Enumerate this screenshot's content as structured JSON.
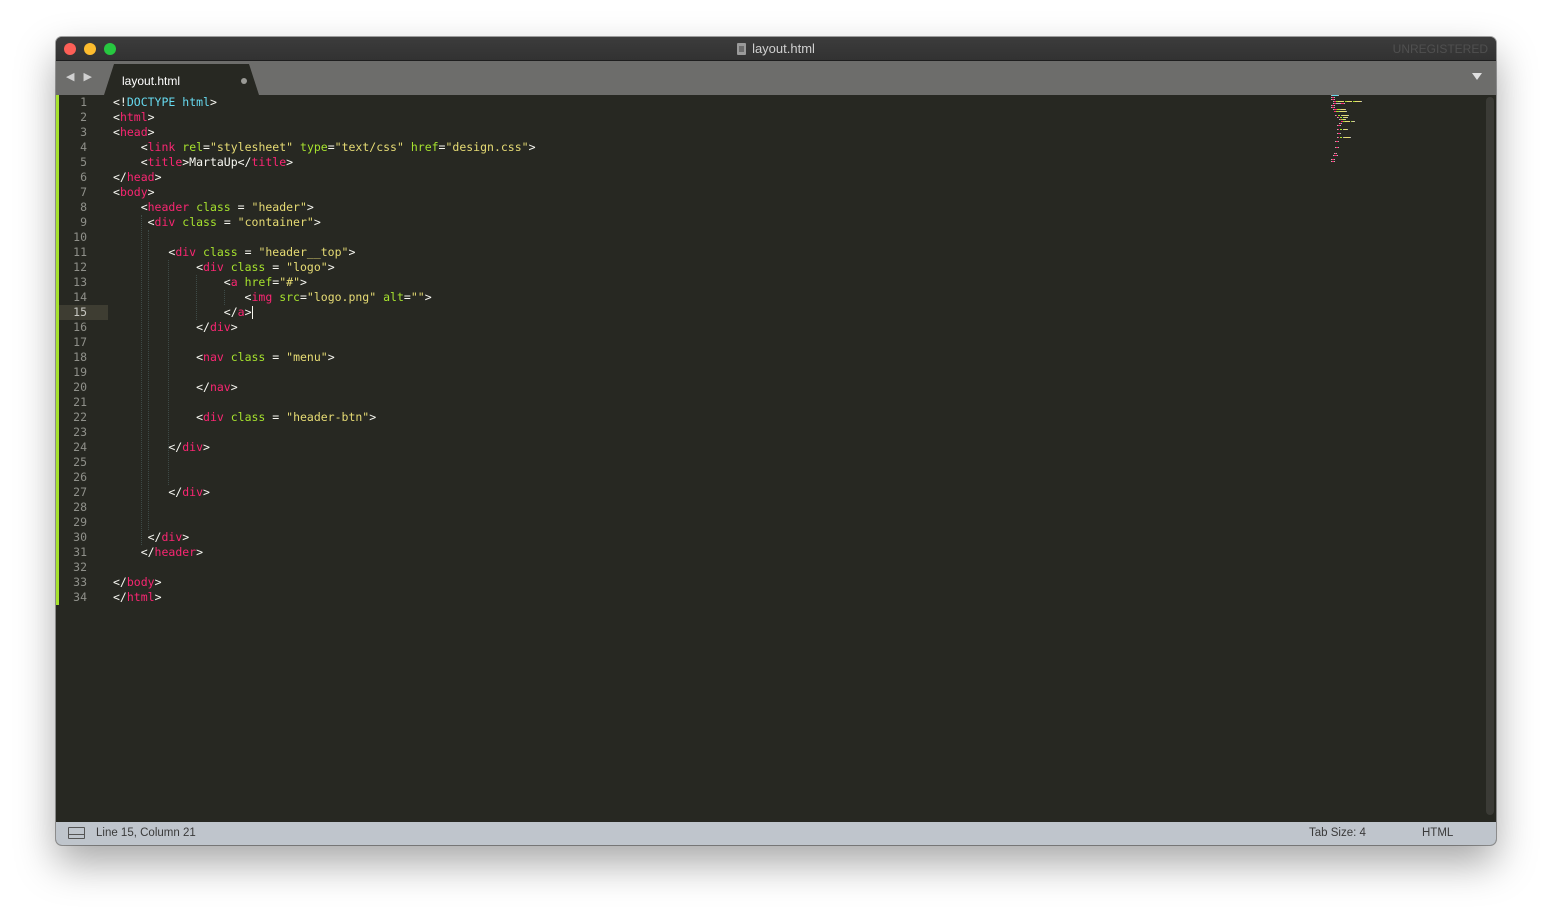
{
  "window": {
    "title": "layout.html",
    "unregistered_label": "UNREGISTERED",
    "traffic_lights": [
      "close",
      "minimize",
      "zoom"
    ]
  },
  "tabs": [
    {
      "label": "layout.html",
      "unsaved": true
    }
  ],
  "editor": {
    "active_line": 15,
    "colors": {
      "background": "#272822",
      "tag": "#f92672",
      "attribute": "#a6e22e",
      "string": "#e6db74",
      "keyword": "#66d9ef",
      "text": "#f8f8f2"
    },
    "lines": [
      [
        [
          "<!",
          ""
        ],
        [
          "DOCTYPE",
          "kw"
        ],
        [
          " ",
          ""
        ],
        [
          "html",
          "kw"
        ],
        [
          ">",
          ""
        ]
      ],
      [
        [
          "<",
          ""
        ],
        [
          "html",
          "tag"
        ],
        [
          ">",
          ""
        ]
      ],
      [
        [
          "<",
          ""
        ],
        [
          "head",
          "tag"
        ],
        [
          ">",
          ""
        ]
      ],
      [
        [
          "    <",
          ""
        ],
        [
          "link",
          "tag"
        ],
        [
          " ",
          ""
        ],
        [
          "rel",
          "attr"
        ],
        [
          "=",
          ""
        ],
        [
          "\"stylesheet\"",
          "str"
        ],
        [
          " ",
          ""
        ],
        [
          "type",
          "attr"
        ],
        [
          "=",
          ""
        ],
        [
          "\"text/css\"",
          "str"
        ],
        [
          " ",
          ""
        ],
        [
          "href",
          "attr"
        ],
        [
          "=",
          ""
        ],
        [
          "\"design.css\"",
          "str"
        ],
        [
          ">",
          ""
        ]
      ],
      [
        [
          "    <",
          ""
        ],
        [
          "title",
          "tag"
        ],
        [
          ">MartaUp</",
          ""
        ],
        [
          "title",
          "tag"
        ],
        [
          ">",
          ""
        ]
      ],
      [
        [
          "</",
          ""
        ],
        [
          "head",
          "tag"
        ],
        [
          ">",
          ""
        ]
      ],
      [
        [
          "<",
          ""
        ],
        [
          "body",
          "tag"
        ],
        [
          ">",
          ""
        ]
      ],
      [
        [
          "    <",
          ""
        ],
        [
          "header",
          "tag"
        ],
        [
          " ",
          ""
        ],
        [
          "class",
          "attr"
        ],
        [
          " = ",
          ""
        ],
        [
          "\"header\"",
          "str"
        ],
        [
          ">",
          ""
        ]
      ],
      [
        [
          "     <",
          ""
        ],
        [
          "div",
          "tag"
        ],
        [
          " ",
          ""
        ],
        [
          "class",
          "attr"
        ],
        [
          " = ",
          ""
        ],
        [
          "\"container\"",
          "str"
        ],
        [
          ">",
          ""
        ]
      ],
      [],
      [
        [
          "        <",
          ""
        ],
        [
          "div",
          "tag"
        ],
        [
          " ",
          ""
        ],
        [
          "class",
          "attr"
        ],
        [
          " = ",
          ""
        ],
        [
          "\"header__top\"",
          "str"
        ],
        [
          ">",
          ""
        ]
      ],
      [
        [
          "            <",
          ""
        ],
        [
          "div",
          "tag"
        ],
        [
          " ",
          ""
        ],
        [
          "class",
          "attr"
        ],
        [
          " = ",
          ""
        ],
        [
          "\"logo\"",
          "str"
        ],
        [
          ">",
          ""
        ]
      ],
      [
        [
          "                <",
          ""
        ],
        [
          "a",
          "tag"
        ],
        [
          " ",
          ""
        ],
        [
          "href",
          "attr"
        ],
        [
          "=",
          ""
        ],
        [
          "\"#\"",
          "str"
        ],
        [
          ">",
          ""
        ]
      ],
      [
        [
          "                   <",
          ""
        ],
        [
          "img",
          "tag"
        ],
        [
          " ",
          ""
        ],
        [
          "src",
          "attr"
        ],
        [
          "=",
          ""
        ],
        [
          "\"logo.png\"",
          "str"
        ],
        [
          " ",
          ""
        ],
        [
          "alt",
          "attr"
        ],
        [
          "=",
          ""
        ],
        [
          "\"\"",
          "str"
        ],
        [
          ">",
          ""
        ]
      ],
      [
        [
          "                </",
          ""
        ],
        [
          "a",
          "tag"
        ],
        [
          ">",
          ""
        ]
      ],
      [
        [
          "            </",
          ""
        ],
        [
          "div",
          "tag"
        ],
        [
          ">",
          ""
        ]
      ],
      [],
      [
        [
          "            <",
          ""
        ],
        [
          "nav",
          "tag"
        ],
        [
          " ",
          ""
        ],
        [
          "class",
          "attr"
        ],
        [
          " = ",
          ""
        ],
        [
          "\"menu\"",
          "str"
        ],
        [
          ">",
          ""
        ]
      ],
      [],
      [
        [
          "            </",
          ""
        ],
        [
          "nav",
          "tag"
        ],
        [
          ">",
          ""
        ]
      ],
      [],
      [
        [
          "            <",
          ""
        ],
        [
          "div",
          "tag"
        ],
        [
          " ",
          ""
        ],
        [
          "class",
          "attr"
        ],
        [
          " = ",
          ""
        ],
        [
          "\"header-btn\"",
          "str"
        ],
        [
          ">",
          ""
        ]
      ],
      [],
      [
        [
          "        </",
          ""
        ],
        [
          "div",
          "tag"
        ],
        [
          ">",
          ""
        ]
      ],
      [],
      [],
      [
        [
          "        </",
          ""
        ],
        [
          "div",
          "tag"
        ],
        [
          ">",
          ""
        ]
      ],
      [],
      [],
      [
        [
          "     </",
          ""
        ],
        [
          "div",
          "tag"
        ],
        [
          ">",
          ""
        ]
      ],
      [
        [
          "    </",
          ""
        ],
        [
          "header",
          "tag"
        ],
        [
          ">",
          ""
        ]
      ],
      [],
      [
        [
          "</",
          ""
        ],
        [
          "body",
          "tag"
        ],
        [
          ">",
          ""
        ]
      ],
      [
        [
          "</",
          ""
        ],
        [
          "html",
          "tag"
        ],
        [
          ">",
          ""
        ]
      ]
    ]
  },
  "statusbar": {
    "position": "Line 15, Column 21",
    "tab_size": "Tab Size: 4",
    "syntax": "HTML"
  }
}
